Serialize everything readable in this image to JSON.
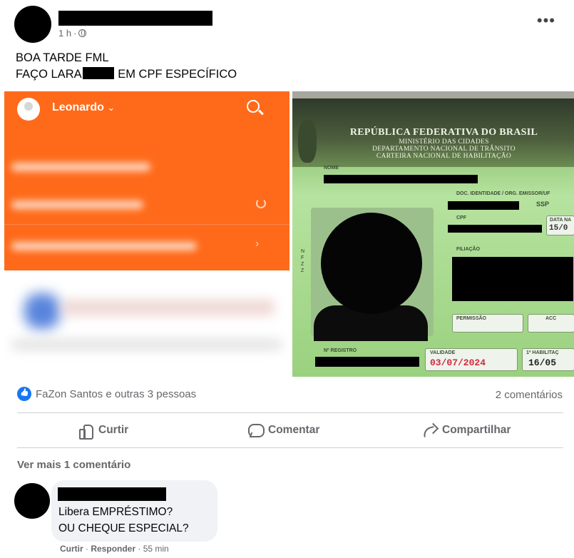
{
  "post": {
    "time": "1 h",
    "separator": "·",
    "menu_icon": "more-horizontal-icon",
    "line1": "BOA TARDE FML",
    "line2_prefix": "FAÇO LARA",
    "line2_suffix": "EM CPF ESPECÍFICO"
  },
  "app_screenshot": {
    "user_name": "Leonardo",
    "chevron": "⌄",
    "accent_color": "#ff6a1a"
  },
  "id_card": {
    "title": "REPÚBLICA FEDERATIVA DO BRASIL",
    "subtitle1": "MINISTÉRIO DAS CIDADES",
    "subtitle2": "DEPARTAMENTO NACIONAL DE TRÂNSITO",
    "subtitle3": "CARTEIRA NACIONAL DE HABILITAÇÃO",
    "nome_label": "NOME",
    "doc_label": "DOC. IDENTIDADE / ORG. EMISSOR/UF",
    "doc_issuer": "SSP",
    "cpf_label": "CPF",
    "nascimento_label": "DATA NA",
    "nascimento_value": "15/0",
    "filiacao_label": "FILIAÇÃO",
    "permissao_label": "PERMISSÃO",
    "acc_label": "ACC",
    "registro_label": "Nº REGISTRO",
    "validade_label": "VALIDADE",
    "validade_value": "03/07/2024",
    "habilitacao_label": "1ª HABILITAÇ",
    "habilitacao_value": "16/05"
  },
  "reactions": {
    "text": "FaZon Santos e outras 3 pessoas",
    "comments": "2 comentários"
  },
  "actions": {
    "like": "Curtir",
    "comment": "Comentar",
    "share": "Compartilhar"
  },
  "more_comments": "Ver mais 1 comentário",
  "comment": {
    "line1": "Libera EMPRÉSTIMO?",
    "line2": "OU CHEQUE ESPECIAL?",
    "like": "Curtir",
    "reply": "Responder",
    "time": "55 min"
  }
}
